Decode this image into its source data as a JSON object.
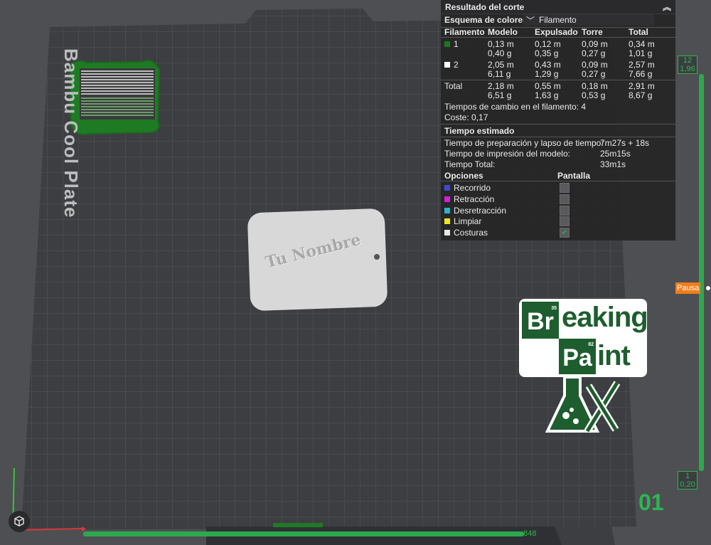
{
  "plate": {
    "label": "Bambu Cool Plate"
  },
  "keychain": {
    "text": "Tu Nombre"
  },
  "logo": {
    "line1_box": "Br",
    "line1_box_num": "35",
    "line1_rest": "eaking",
    "line2_box": "Pa",
    "line2_box_num": "82",
    "line2_rest": "int"
  },
  "panel": {
    "title": "Resultado del corte",
    "scheme_label": "Esquema de colores",
    "scheme_value": "Filamento",
    "headers": [
      "Filamento",
      "Modelo",
      "Expulsado",
      "Torre",
      "Total"
    ],
    "filaments": [
      {
        "id": "1",
        "color": "#1a7a1a",
        "model_m": "0,13 m",
        "model_g": "0,40 g",
        "purge_m": "0,12 m",
        "purge_g": "0,35 g",
        "tower_m": "0,09 m",
        "tower_g": "0,27 g",
        "total_m": "0,34 m",
        "total_g": "1,01 g"
      },
      {
        "id": "2",
        "color": "#ffffff",
        "model_m": "2,05 m",
        "model_g": "6,11 g",
        "purge_m": "0,43 m",
        "purge_g": "1,29 g",
        "tower_m": "0,09 m",
        "tower_g": "0,27 g",
        "total_m": "2,57 m",
        "total_g": "7,66 g"
      }
    ],
    "total": {
      "label": "Total",
      "model_m": "2,18 m",
      "model_g": "6,51 g",
      "purge_m": "0,55 m",
      "purge_g": "1,63 g",
      "tower_m": "0,18 m",
      "tower_g": "0,53 g",
      "total_m": "2,91 m",
      "total_g": "8,67 g"
    },
    "change_times": "Tiempos de cambio en el filamento: 4",
    "cost": "Coste: 0,17",
    "time_title": "Tiempo estimado",
    "prep_label": "Tiempo de preparación y lapso de tiempo:",
    "prep_value": "7m27s + 18s",
    "print_label": "Tiempo de impresión del modelo:",
    "print_value": "25m15s",
    "total_label": "Tiempo Total:",
    "total_value": "33m1s",
    "options_label": "Opciones",
    "display_label": "Pantalla",
    "options": [
      {
        "name": "Recorrido",
        "color": "#3b4bd6",
        "checked": false
      },
      {
        "name": "Retracción",
        "color": "#d61fd6",
        "checked": false
      },
      {
        "name": "Desretracción",
        "color": "#2fb3c9",
        "checked": false
      },
      {
        "name": "Limpiar",
        "color": "#f0e81a",
        "checked": false
      },
      {
        "name": "Costuras",
        "color": "#e6e6e6",
        "checked": true
      }
    ]
  },
  "vslider": {
    "top_layer": "12",
    "top_height": "1,96",
    "bottom_layer": "1",
    "bottom_height": "0,20",
    "pause_label": "Pausa",
    "current_layer": "01"
  },
  "hslider": {
    "value": "848"
  },
  "colors": {
    "accent": "#2eb552",
    "panel_bg": "#262628",
    "pause": "#f07d1c"
  }
}
